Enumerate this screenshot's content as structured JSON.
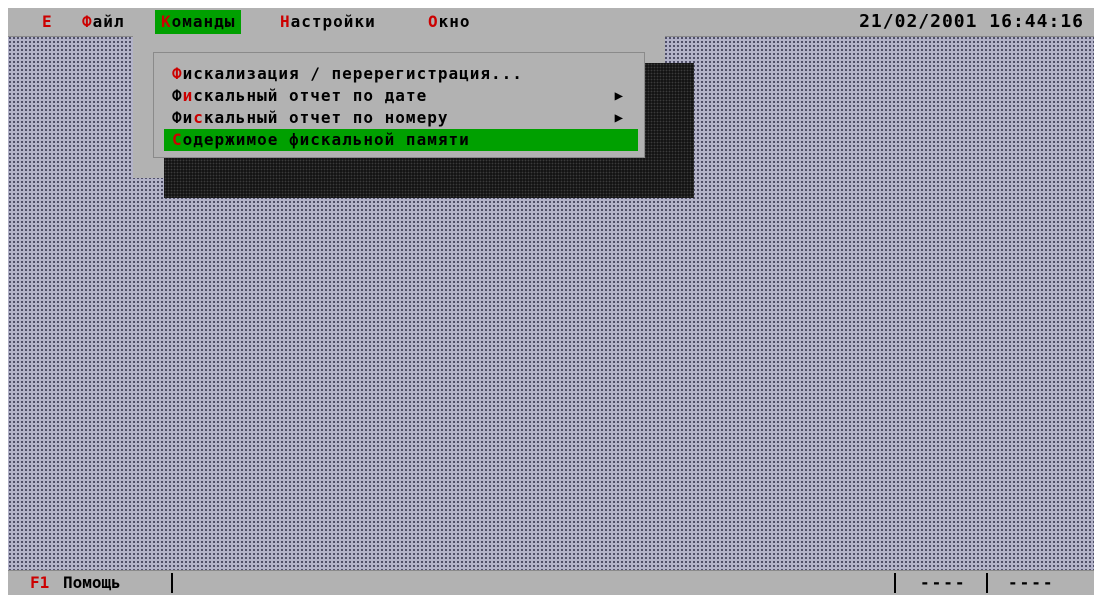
{
  "menu_bar": {
    "system_hotkey": "E",
    "items": [
      {
        "hotkey": "Ф",
        "rest": "айл"
      },
      {
        "hotkey": "К",
        "rest": "оманды"
      },
      {
        "hotkey": "Н",
        "rest": "астройки"
      },
      {
        "hotkey": "О",
        "rest": "кно"
      }
    ],
    "active_item": "Команды",
    "datetime": "21/02/2001 16:44:16"
  },
  "dropdown": {
    "items": [
      {
        "pre": "",
        "hotkey": "Ф",
        "rest": "искализация / перерегистрация...",
        "submenu": false
      },
      {
        "pre": "Ф",
        "hotkey": "и",
        "rest": "скальный отчет по дате",
        "submenu": true
      },
      {
        "pre": "Фи",
        "hotkey": "с",
        "rest": "кальный отчет по номеру",
        "submenu": true
      },
      {
        "pre": "",
        "hotkey": "С",
        "rest": "одержимое фискальной памяти",
        "submenu": false
      }
    ],
    "selected_index": 3,
    "submenu_arrow": "▶"
  },
  "status_bar": {
    "help_key": "F1",
    "help_label": "Помощь",
    "indicator_1": "----",
    "indicator_2": "----"
  },
  "colors": {
    "hotkey": "#cc0000",
    "highlight": "#00a000",
    "panel": "#b2b2b2",
    "desktop": "#b2b2c8"
  }
}
